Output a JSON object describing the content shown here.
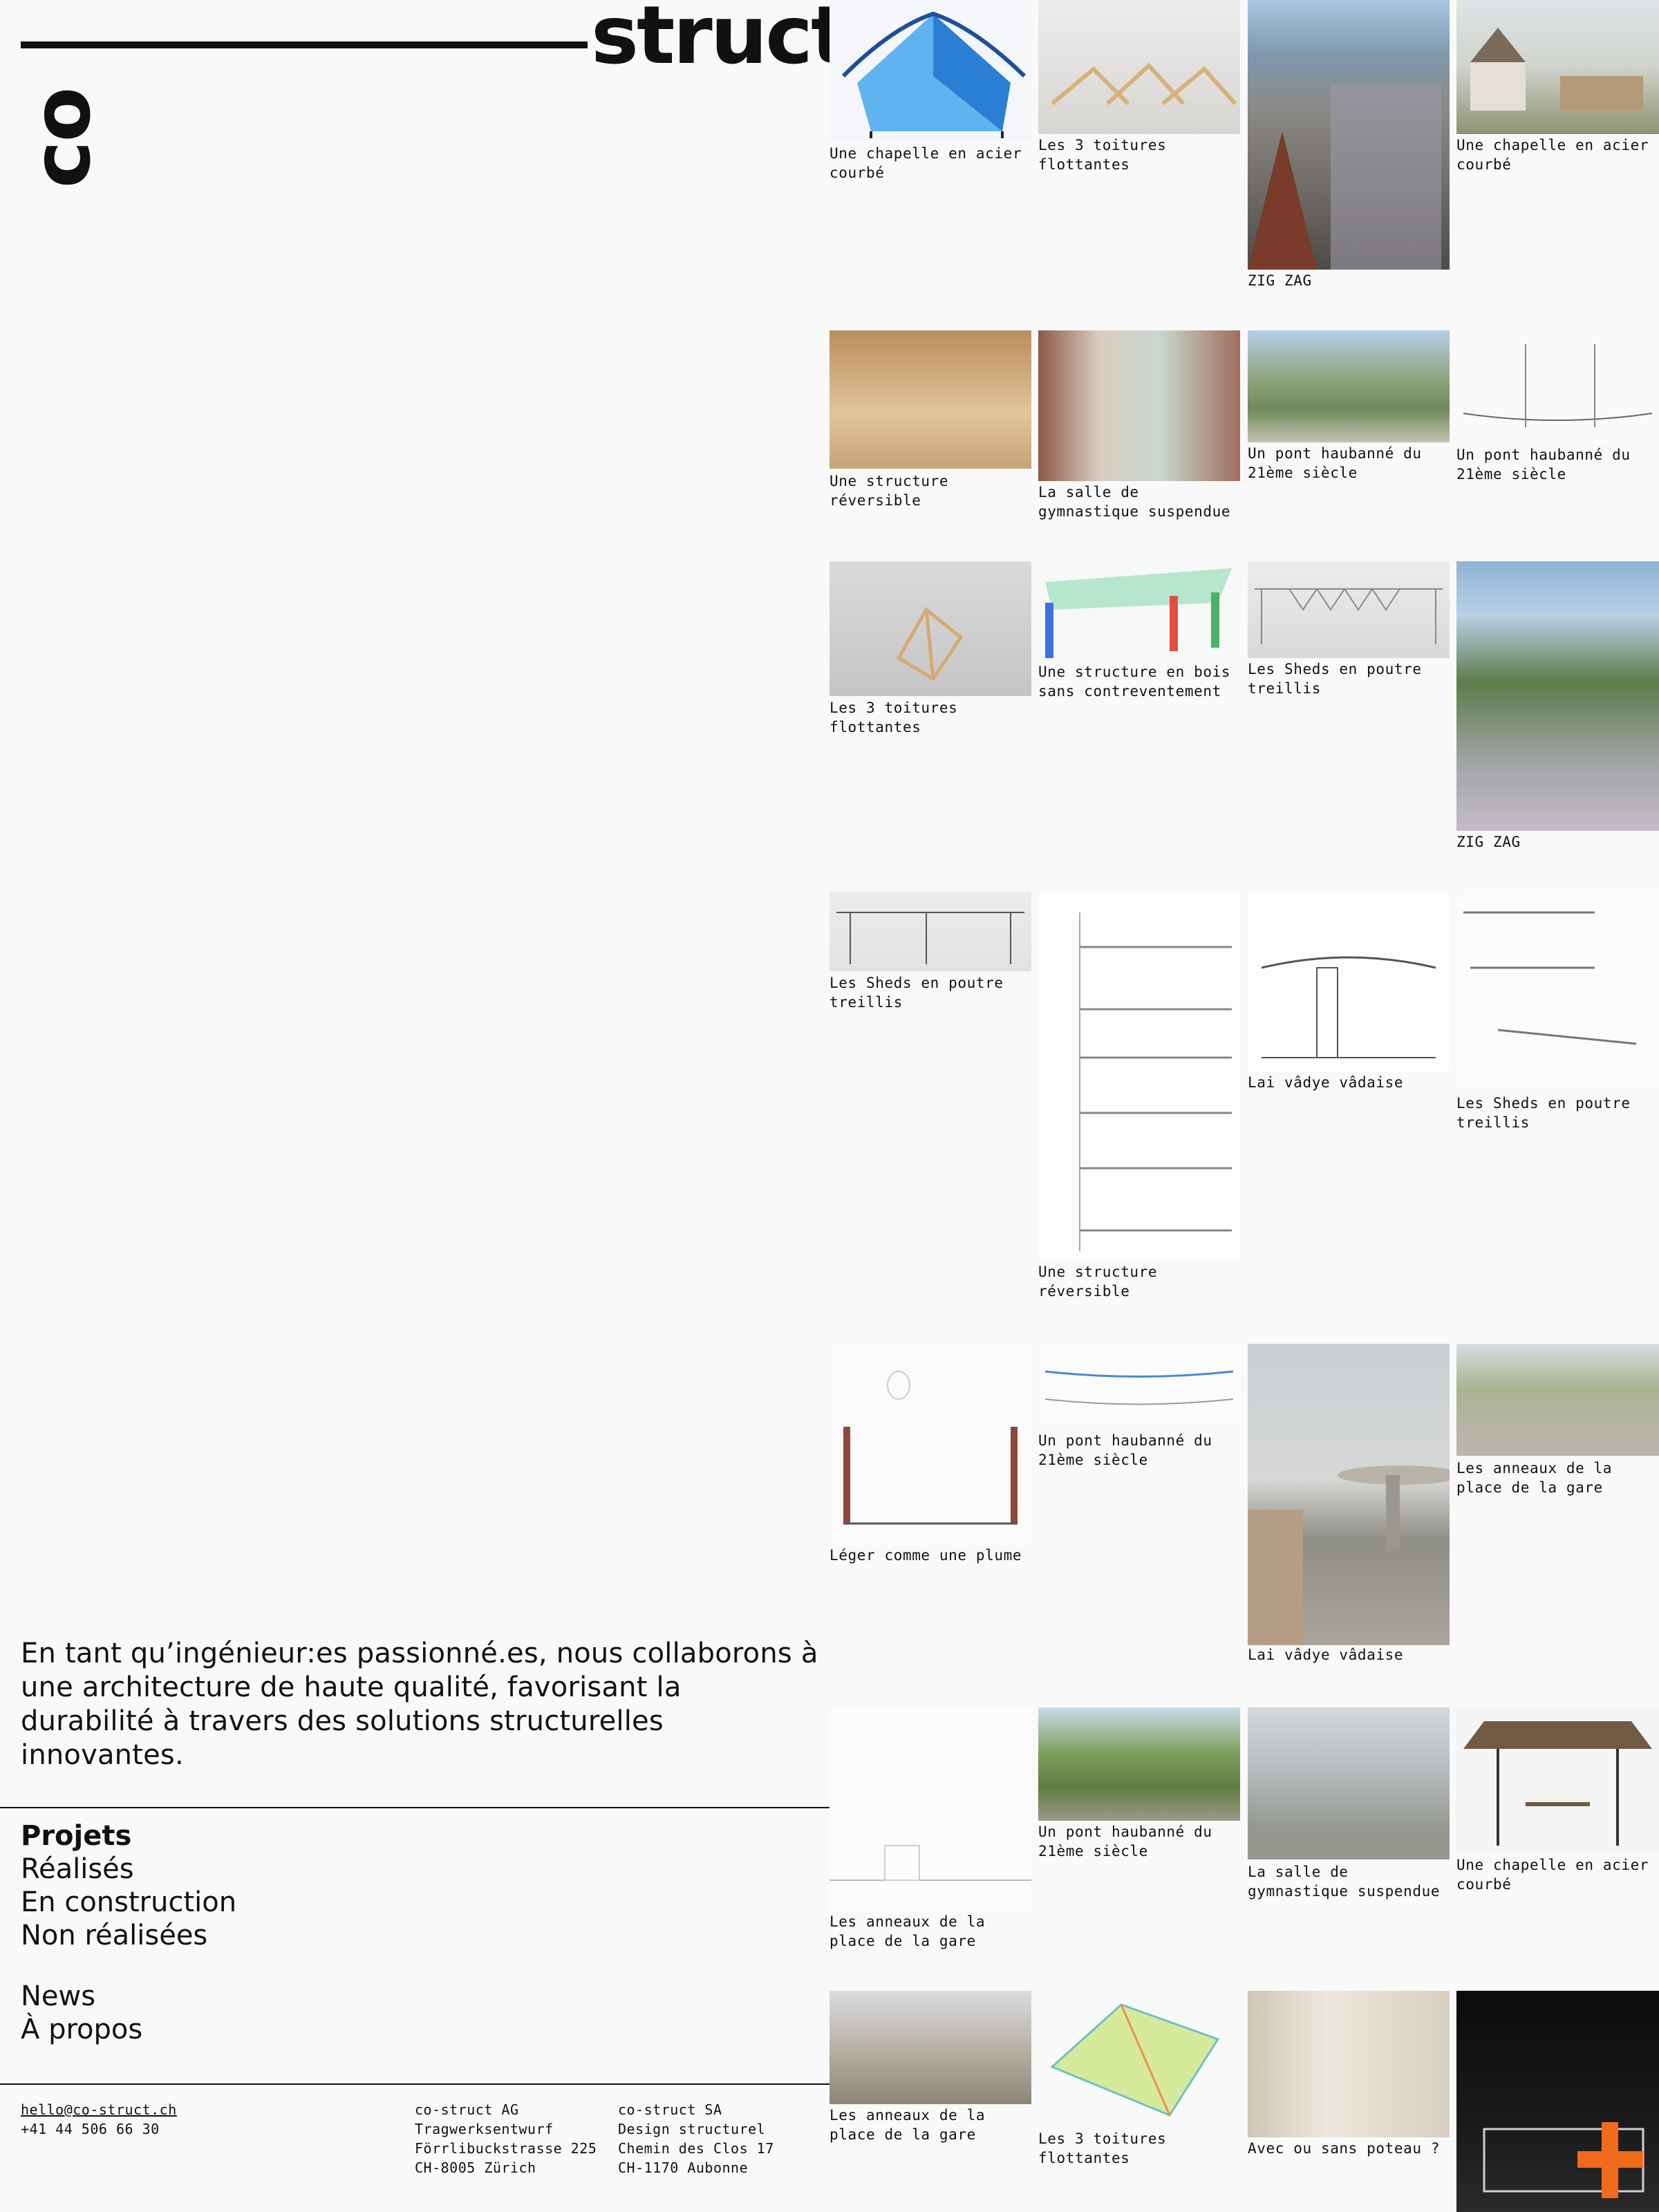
{
  "logo": {
    "co": "co",
    "struct": "struct"
  },
  "intro": "En tant qu’ingénieur:es passionné.es, nous collaborons à une architecture de haute qualité, favorisant la durabilité à travers des solutions structurelles innovantes.",
  "nav": {
    "projects": "Projets",
    "realises": "Réalisés",
    "en_construction": "En construction",
    "non_realisees": "Non réalisées",
    "news": "News",
    "apropos": "À propos"
  },
  "footer": {
    "email": "hello@co-struct.ch",
    "phone": "+41 44 506 66 30",
    "office1": [
      "co-struct AG",
      "Tragwerksentwurf",
      "Förrlibuckstrasse 225",
      "CH-8005 Zürich"
    ],
    "office2": [
      "co-struct SA",
      "Design structurel",
      "Chemin des Clos 17",
      "CH-1170 Aubonne"
    ]
  },
  "tiles": [
    {
      "caption": "Une chapelle en acier\ncourbé"
    },
    {
      "caption": "Les 3 toitures\nflottantes"
    },
    {
      "caption": "ZIG ZAG"
    },
    {
      "caption": "Une chapelle en acier\ncourbé"
    },
    {
      "caption": "Une structure\nréversible"
    },
    {
      "caption": "La salle de\ngymnastique suspendue"
    },
    {
      "caption": "Un pont haubanné du\n21ème siècle"
    },
    {
      "caption": "Un pont haubanné du\n21ème siècle"
    },
    {
      "caption": "Les 3 toitures\nflottantes"
    },
    {
      "caption": "Une structure en bois\nsans contreventement"
    },
    {
      "caption": "Les Sheds en poutre\ntreillis"
    },
    {
      "caption": "ZIG ZAG"
    },
    {
      "caption": "Les Sheds en poutre\ntreillis"
    },
    {
      "caption": "Une structure\nréversible"
    },
    {
      "caption": "Lai vâdye vâdaise"
    },
    {
      "caption": "Les Sheds en poutre\ntreillis"
    },
    {
      "caption": "Léger comme une plume"
    },
    {
      "caption": "Un pont haubanné du\n21ème siècle"
    },
    {
      "caption": "Lai vâdye vâdaise"
    },
    {
      "caption": "Les anneaux de la\nplace de la gare"
    },
    {
      "caption": "Les anneaux de la\nplace de la gare"
    },
    {
      "caption": "Un pont haubanné du\n21ème siècle"
    },
    {
      "caption": "La salle de\ngymnastique suspendue"
    },
    {
      "caption": "Une chapelle en acier\ncourbé"
    },
    {
      "caption": "Les anneaux de la\nplace de la gare"
    },
    {
      "caption": "Les 3 toitures\nflottantes"
    },
    {
      "caption": "Avec ou sans poteau ?"
    },
    {
      "caption": ""
    }
  ]
}
